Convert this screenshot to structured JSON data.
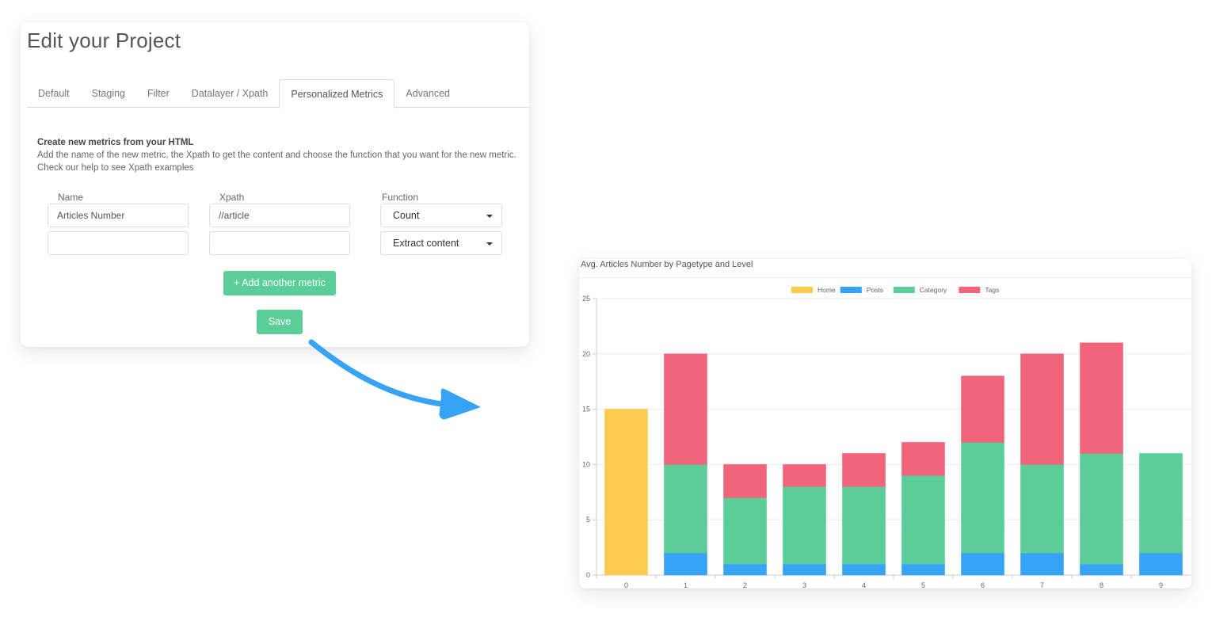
{
  "form": {
    "title": "Edit your Project",
    "tabs": [
      {
        "label": "Default",
        "active": false
      },
      {
        "label": "Staging",
        "active": false
      },
      {
        "label": "Filter",
        "active": false
      },
      {
        "label": "Datalayer / Xpath",
        "active": false
      },
      {
        "label": "Personalized Metrics",
        "active": true
      },
      {
        "label": "Advanced",
        "active": false
      }
    ],
    "intro": {
      "heading": "Create new metrics from your HTML",
      "line1": "Add the name of the new metric, the Xpath to get the content and choose the function that you want for the new metric.",
      "line2": "Check our help to see Xpath examples"
    },
    "columns": {
      "name": "Name",
      "xpath": "Xpath",
      "function": "Function"
    },
    "rows": [
      {
        "name": "Articles Number",
        "xpath": "//article",
        "function": "Count"
      },
      {
        "name": "",
        "xpath": "",
        "function": "Extract content"
      }
    ],
    "add_button": "+ Add another metric",
    "save_button": "Save",
    "accent_color": "#5bcd98"
  },
  "arrow": {
    "icon": "curved-arrow-right-icon",
    "color": "#36a3f7"
  },
  "chart_data": {
    "type": "bar",
    "stacked": true,
    "title": "Avg. Articles Number by Pagetype and Level",
    "xlabel": "",
    "ylabel": "",
    "categories": [
      "0",
      "1",
      "2",
      "3",
      "4",
      "5",
      "6",
      "7",
      "8",
      "9"
    ],
    "ylim": [
      0,
      25
    ],
    "yticks": [
      0,
      5,
      10,
      15,
      20,
      25
    ],
    "grid": true,
    "legend_position": "top-center",
    "series": [
      {
        "name": "Home",
        "color": "#fccb52",
        "values": [
          15,
          0,
          0,
          0,
          0,
          0,
          0,
          0,
          0,
          0
        ]
      },
      {
        "name": "Posts",
        "color": "#36a3f7",
        "values": [
          0,
          2,
          1,
          1,
          1,
          1,
          2,
          2,
          1,
          2
        ]
      },
      {
        "name": "Category",
        "color": "#5bcd98",
        "values": [
          0,
          8,
          6,
          7,
          7,
          8,
          10,
          8,
          10,
          9
        ]
      },
      {
        "name": "Tags",
        "color": "#f0657c",
        "values": [
          0,
          10,
          3,
          2,
          3,
          3,
          6,
          10,
          10,
          0
        ]
      }
    ]
  }
}
